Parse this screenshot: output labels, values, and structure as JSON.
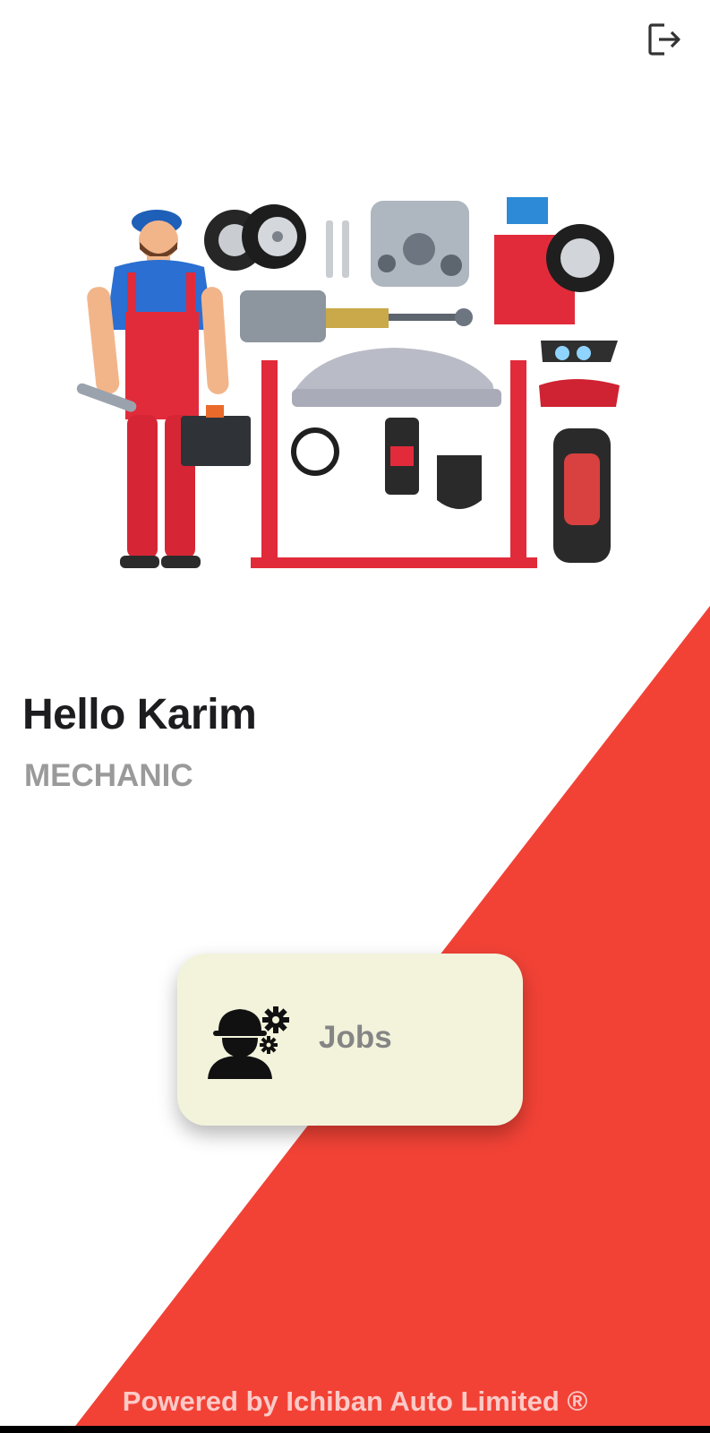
{
  "header": {
    "logout_icon": "logout-icon"
  },
  "hero": {
    "illustration": "mechanic-with-car-parts-illustration"
  },
  "user": {
    "greeting": "Hello Karim",
    "role": "MECHANIC"
  },
  "menu": {
    "jobs_label": "Jobs",
    "jobs_icon": "worker-gears-icon"
  },
  "footer": {
    "text": "Powered by Ichiban Auto Limited ®"
  },
  "colors": {
    "accent_red": "#f24236",
    "card_bg": "#f3f3dc",
    "text_dark": "#1d1d1f",
    "text_muted": "#9a9a9a"
  }
}
